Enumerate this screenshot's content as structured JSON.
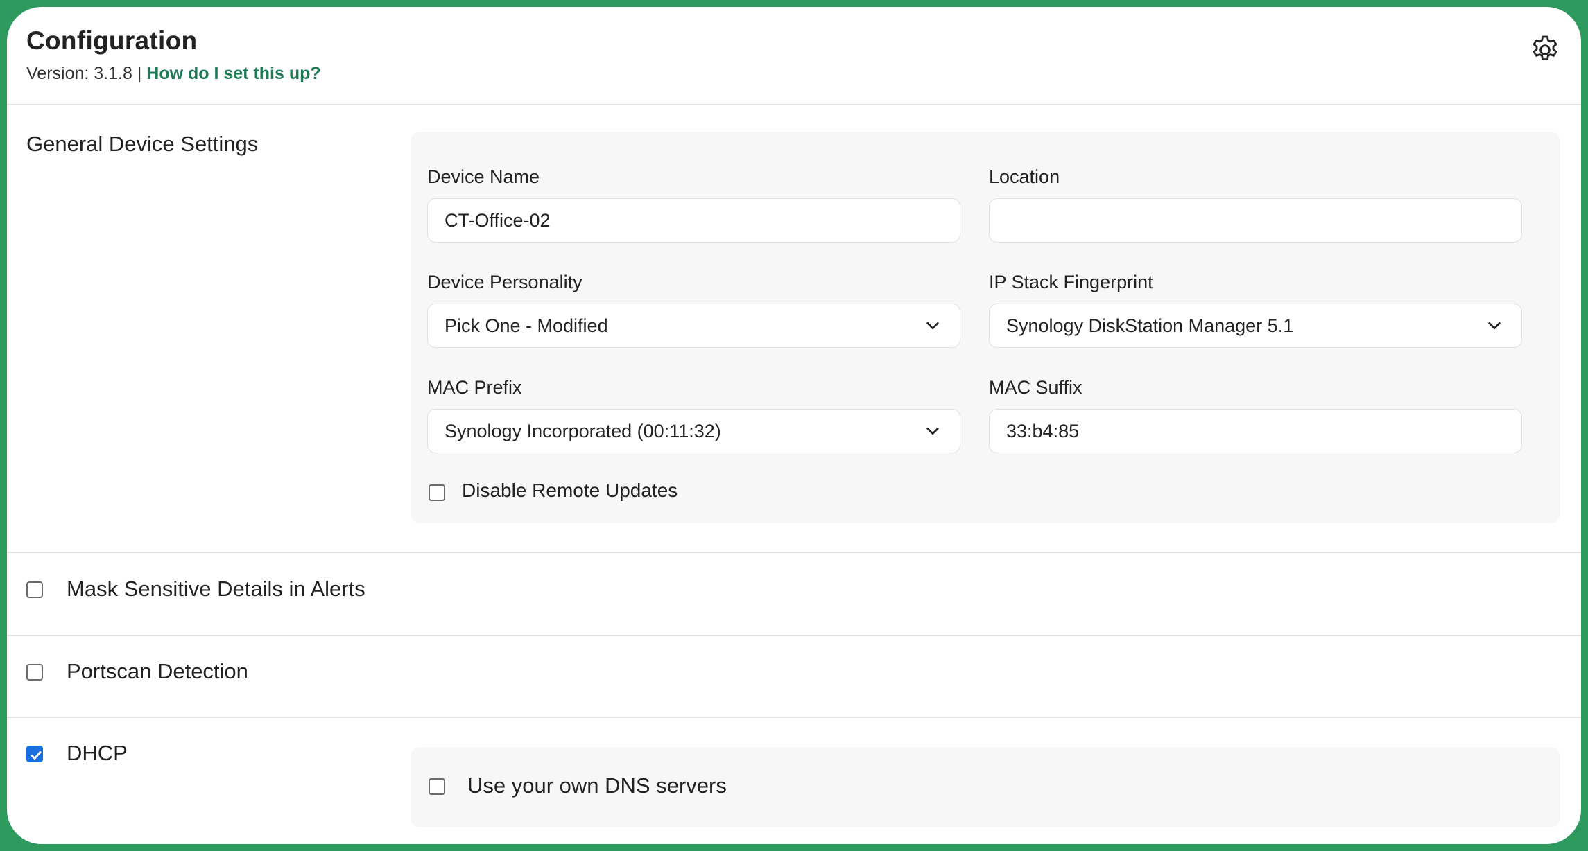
{
  "header": {
    "title": "Configuration",
    "version_text": "Version: 3.1.8 |",
    "help_link": "How do I set this up?",
    "settings_icon": "gear-icon"
  },
  "general": {
    "section_label": "General Device Settings",
    "device_name": {
      "label": "Device Name",
      "value": "CT-Office-02"
    },
    "location": {
      "label": "Location",
      "value": ""
    },
    "device_personality": {
      "label": "Device Personality",
      "value": "Pick One - Modified"
    },
    "ip_stack_fingerprint": {
      "label": "IP Stack Fingerprint",
      "value": "Synology DiskStation Manager 5.1"
    },
    "mac_prefix": {
      "label": "MAC Prefix",
      "value": "Synology Incorporated (00:11:32)"
    },
    "mac_suffix": {
      "label": "MAC Suffix",
      "value": "33:b4:85"
    },
    "disable_remote_updates": {
      "label": "Disable Remote Updates",
      "checked": false
    }
  },
  "mask_sensitive": {
    "label": "Mask Sensitive Details in Alerts",
    "checked": false
  },
  "portscan": {
    "label": "Portscan Detection",
    "checked": false
  },
  "dhcp": {
    "label": "DHCP",
    "checked": true,
    "own_dns": {
      "label": "Use your own DNS servers",
      "checked": false
    }
  },
  "colors": {
    "frame": "#2e9a5e",
    "link": "#1e7a56",
    "checkbox_checked": "#1a6fe0",
    "panel": "#f7f7f8"
  }
}
